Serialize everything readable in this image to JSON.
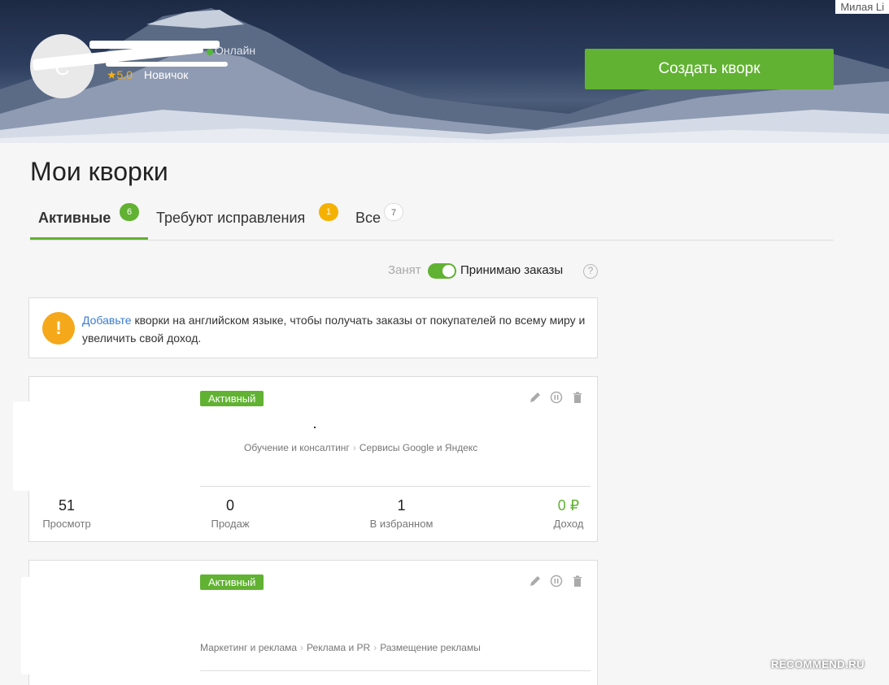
{
  "header": {
    "username_corner": "Милая Li",
    "avatar_letter": "С",
    "online_label": "Онлайн",
    "rating": "★5.0",
    "level": "Новичок",
    "create_button": "Создать кворк"
  },
  "page": {
    "title": "Мои кворки",
    "tabs": [
      {
        "label": "Активные",
        "count": "6"
      },
      {
        "label": "Требуют исправления",
        "count": "1"
      },
      {
        "label": "Все",
        "count": "7"
      }
    ],
    "status_busy": "Занят",
    "status_accepting": "Принимаю заказы",
    "help": "?"
  },
  "notice": {
    "icon": "!",
    "link_text": "Добавьте",
    "text": " кворки на английском языке, чтобы получать заказы от покупателей по всему миру и увеличить свой доход."
  },
  "cards": [
    {
      "status": "Активный",
      "categories": [
        "Обучение и консалтинг",
        "Сервисы Google и Яндекс"
      ],
      "stats": [
        {
          "value": "51",
          "label": "Просмотр"
        },
        {
          "value": "0",
          "label": "Продаж"
        },
        {
          "value": "1",
          "label": "В избранном"
        },
        {
          "value": "0 ₽",
          "label": "Доход"
        }
      ]
    },
    {
      "status": "Активный",
      "categories": [
        "Маркетинг и реклама",
        "Реклама и PR",
        "Размещение рекламы"
      ]
    }
  ],
  "watermark": "RECOMMEND.RU",
  "colors": {
    "accent": "#61b232",
    "warning": "#f5a81a",
    "link": "#3a7bd5"
  }
}
